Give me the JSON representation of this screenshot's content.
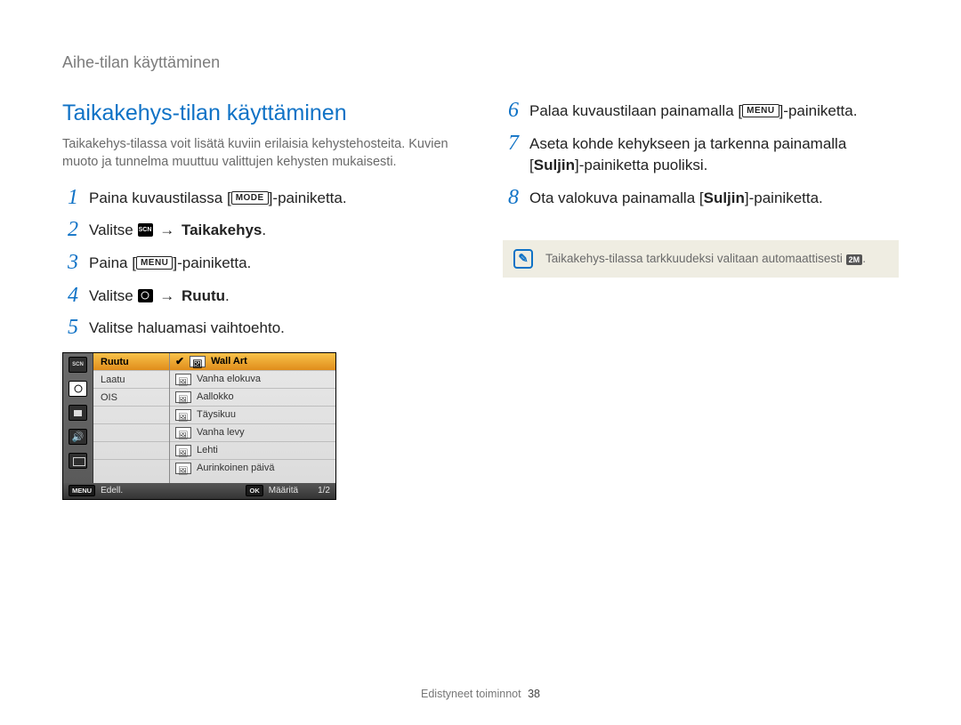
{
  "header": {
    "breadcrumb": "Aihe-tilan käyttäminen"
  },
  "section": {
    "title": "Taikakehys-tilan käyttäminen",
    "intro": "Taikakehys-tilassa voit lisätä kuviin erilaisia kehystehosteita. Kuvien muoto ja tunnelma muuttuu valittujen kehysten mukaisesti."
  },
  "icons": {
    "mode": "MODE",
    "menu": "MENU",
    "ok": "OK",
    "size_badge": "2M"
  },
  "steps_left": [
    {
      "n": "1",
      "pre": "Paina kuvaustilassa [",
      "icon": "mode",
      "post": "]-painiketta."
    },
    {
      "n": "2",
      "pre": "Valitse ",
      "icon": "scn",
      "arrow": " → ",
      "bold": "Taikakehys",
      "post": "."
    },
    {
      "n": "3",
      "pre": "Paina [",
      "icon": "menu",
      "post": "]-painiketta."
    },
    {
      "n": "4",
      "pre": "Valitse ",
      "icon": "cam",
      "arrow": " → ",
      "bold": "Ruutu",
      "post": "."
    },
    {
      "n": "5",
      "text": "Valitse haluamasi vaihtoehto."
    }
  ],
  "steps_right": [
    {
      "n": "6",
      "pre": "Palaa kuvaustilaan painamalla [",
      "icon": "menu",
      "post": "]-painiketta."
    },
    {
      "n": "7",
      "pre": "Aseta kohde kehykseen ja tarkenna painamalla [",
      "bold": "Suljin",
      "post": "]-painiketta puoliksi."
    },
    {
      "n": "8",
      "pre": "Ota valokuva painamalla [",
      "bold": "Suljin",
      "post": "]-painiketta."
    }
  ],
  "shot": {
    "mid_rows": [
      "Ruutu",
      "Laatu",
      "OIS"
    ],
    "mid_active_index": 0,
    "options": [
      "Wall Art",
      "Vanha elokuva",
      "Aallokko",
      "Täysikuu",
      "Vanha levy",
      "Lehti",
      "Aurinkoinen päivä"
    ],
    "options_active_index": 0,
    "footer": {
      "back_key": "MENU",
      "back": "Edell.",
      "ok_key": "OK",
      "set": "Määritä",
      "page": "1/2"
    }
  },
  "note": {
    "text_pre": "Taikakehys-tilassa tarkkuudeksi valitaan automaattisesti ",
    "text_post": "."
  },
  "footer": {
    "section": "Edistyneet toiminnot",
    "page": "38"
  }
}
